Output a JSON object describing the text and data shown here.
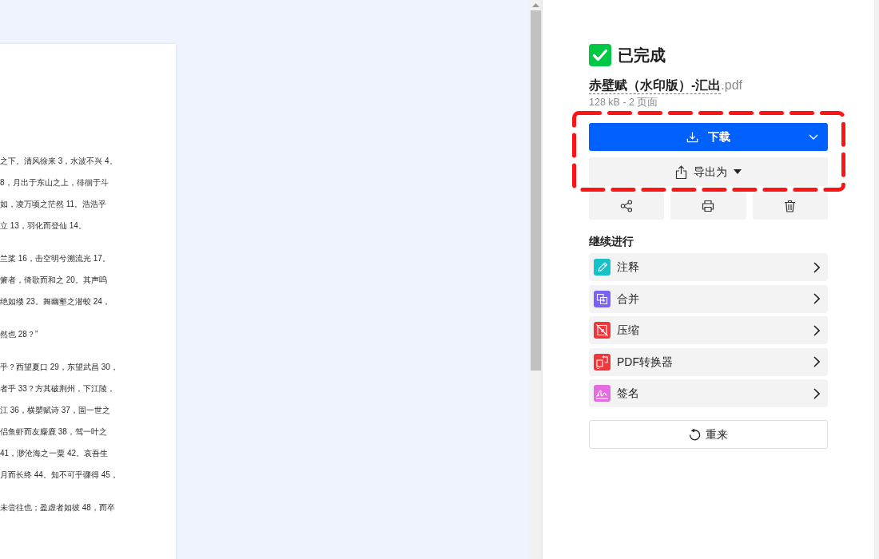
{
  "document": {
    "paragraphs": [
      {
        "lines": [
          "之下。清风徐来 3，水波不兴 4。",
          "8，月出于东山之上，徘徊于斗",
          "如，凌万顷之茫然 11。浩浩乎",
          "立 13，羽化而登仙 14。"
        ]
      },
      {
        "lines": [
          "兰桨 16，击空明兮溯流光 17。",
          "箫者，倚歌而和之 20。其声呜",
          "绝如缕 23。舞幽壑之潜蛟 24，"
        ]
      },
      {
        "lines": [
          "然也 28？”"
        ]
      },
      {
        "lines": [
          "乎？西望夏口 29，东望武昌 30，",
          "者乎 33？方其破荆州，下江陵，",
          "江 36，横槊赋诗 37，固一世之",
          "侣鱼虾而友麋鹿 38，驾一叶之",
          "41，渺沧海之一粟 42。哀吾生",
          "月而长终 44。知不可乎骤得 45，"
        ]
      },
      {
        "lines": [
          "未尝往也；盈虚者如彼 48，而卒"
        ]
      }
    ]
  },
  "result_panel": {
    "status": {
      "title": "已完成"
    },
    "file": {
      "name": "赤壁赋（水印版）-汇出",
      "extension": ".pdf",
      "meta": "128 kB - 2 页面"
    },
    "primary_actions": {
      "highlighted": true,
      "download": {
        "label": "下载"
      },
      "export": {
        "label": "导出为"
      }
    },
    "icon_actions": [
      {
        "kind": "share"
      },
      {
        "kind": "print"
      },
      {
        "kind": "delete"
      }
    ],
    "continue": {
      "heading": "继续进行",
      "tools": [
        {
          "kind": "annotate",
          "label": "注释",
          "color": "#17c1c8"
        },
        {
          "kind": "merge",
          "label": "合并",
          "color": "#7b61f5"
        },
        {
          "kind": "compress",
          "label": "压缩",
          "color": "#f2373c"
        },
        {
          "kind": "convert",
          "label": "PDF转换器",
          "color": "#f2373c"
        },
        {
          "kind": "sign",
          "label": "签名",
          "color": "#e46be0"
        }
      ]
    },
    "restart": {
      "label": "重来"
    }
  }
}
